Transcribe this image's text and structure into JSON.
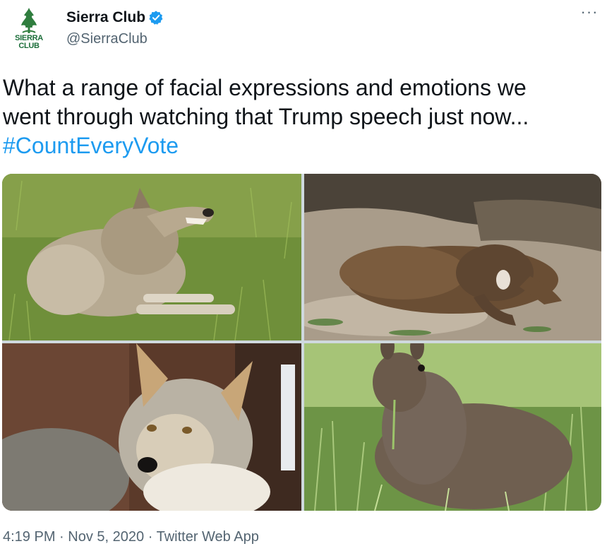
{
  "account": {
    "display_name": "Sierra Club",
    "handle": "@SierraClub",
    "verified": true,
    "avatar_text_line1": "SIERRA",
    "avatar_text_line2": "CLUB"
  },
  "tweet": {
    "line1": "What a range of facial expressions and emotions we",
    "line2": "went through watching that Trump speech just now...",
    "hashtag": "#CountEveryVote"
  },
  "media": [
    {
      "subject": "wolf-snarling-photo"
    },
    {
      "subject": "marmot-yawning-photo"
    },
    {
      "subject": "coyote-portrait-photo"
    },
    {
      "subject": "hare-eating-grass-photo"
    }
  ],
  "meta": {
    "time": "4:19 PM",
    "separator": "·",
    "date": "Nov 5, 2020",
    "source": "Twitter Web App"
  },
  "more_menu": "···",
  "colors": {
    "link": "#1d9bf0",
    "text": "#0f1419",
    "secondary": "#536471",
    "brand_green": "#1c6e3a",
    "verified_blue": "#1d9bf0"
  }
}
